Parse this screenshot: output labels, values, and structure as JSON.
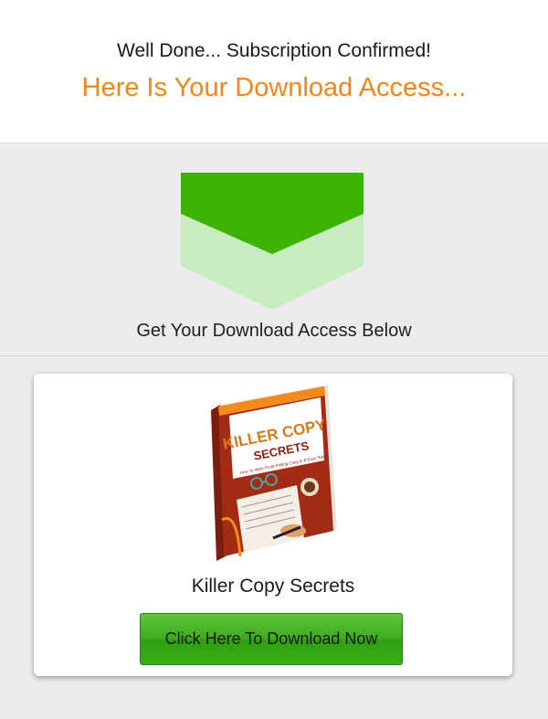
{
  "header": {
    "subtitle": "Well Done... Subscription Confirmed!",
    "headline": "Here Is Your Download Access..."
  },
  "arrow_section": {
    "icon": "chevron-down-icon",
    "text": "Get Your Download Access Below"
  },
  "product": {
    "cover": {
      "title_line1": "KILLER COPY",
      "title_line2": "SECRETS",
      "tagline": "How To Write Profit-Pulling Copy In 8 Easy Steps"
    },
    "name": "Killer Copy Secrets",
    "download_label": "Click Here To Download Now"
  },
  "colors": {
    "accent_orange": "#f0861c",
    "arrow_green": "#3cb300",
    "arrow_green_light": "#c9ebc0",
    "button_green": "#3faa1c"
  }
}
